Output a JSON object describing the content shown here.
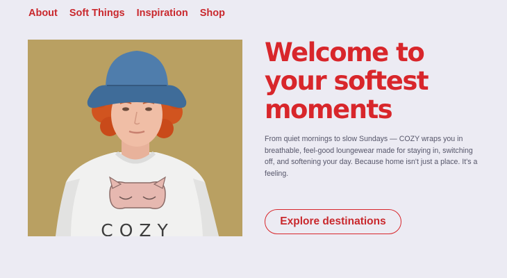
{
  "nav": {
    "items": [
      {
        "label": "About"
      },
      {
        "label": "Soft Things"
      },
      {
        "label": "Inspiration"
      },
      {
        "label": "Shop"
      }
    ]
  },
  "hero": {
    "headline": "Welcome to your softest moments",
    "description": "From quiet mornings to slow Sundays — COZY wraps you in breathable, feel-good loungewear made for staying in, switching off, and softening your day. Because home isn't just a place. It's a feeling.",
    "cta_label": "Explore destinations",
    "image": {
      "shirt_print": "COZY",
      "background_color": "#b9a062"
    }
  },
  "colors": {
    "accent": "#d8262b",
    "page_background": "#ecebf3",
    "body_text": "#56566a"
  }
}
